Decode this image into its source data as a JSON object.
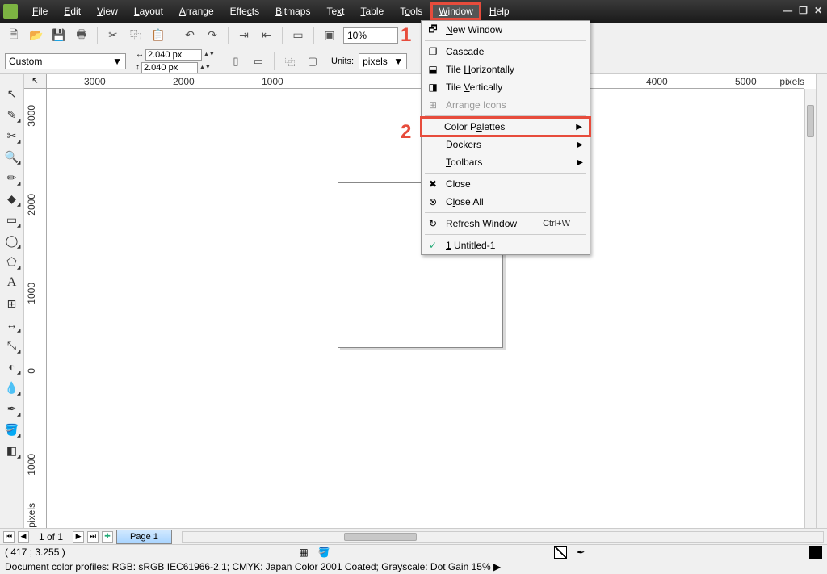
{
  "menubar": {
    "file": "File",
    "edit": "Edit",
    "view": "View",
    "layout": "Layout",
    "arrange": "Arrange",
    "effects": "Effects",
    "bitmaps": "Bitmaps",
    "text": "Text",
    "table": "Table",
    "tools": "Tools",
    "window": "Window",
    "help": "Help"
  },
  "window_menu": {
    "new_window": "New Window",
    "cascade": "Cascade",
    "tile_h": "Tile Horizontally",
    "tile_v": "Tile Vertically",
    "arrange_icons": "Arrange Icons",
    "color_palettes": "Color Palettes",
    "dockers": "Dockers",
    "toolbars": "Toolbars",
    "close": "Close",
    "close_all": "Close All",
    "refresh": "Refresh Window",
    "refresh_shortcut": "Ctrl+W",
    "doc1": "1 Untitled-1"
  },
  "callouts": {
    "c1": "1",
    "c2": "2"
  },
  "toolbar": {
    "zoom": "10%"
  },
  "propbar": {
    "preset": "Custom",
    "width": "2.040 px",
    "height": "2.040 px",
    "units_label": "Units:",
    "units_value": "pixels"
  },
  "ruler": {
    "h_units": "pixels",
    "v_units": "pixels",
    "h_ticks": [
      "3000",
      "2000",
      "1000",
      "4000",
      "5000"
    ],
    "h_positions": [
      46,
      156,
      266,
      742,
      852
    ],
    "v_ticks": [
      "3000",
      "2000",
      "1000",
      "0",
      "1000"
    ],
    "v_positions": [
      20,
      130,
      240,
      346,
      452
    ]
  },
  "pagebar": {
    "of": "1 of 1",
    "page_tab": "Page 1"
  },
  "status": {
    "coords": "( 417  ; 3.255  )",
    "profiles": "Document color profiles: RGB: sRGB IEC61966-2.1; CMYK: Japan Color 2001 Coated; Grayscale: Dot Gain 15%  ▶"
  }
}
